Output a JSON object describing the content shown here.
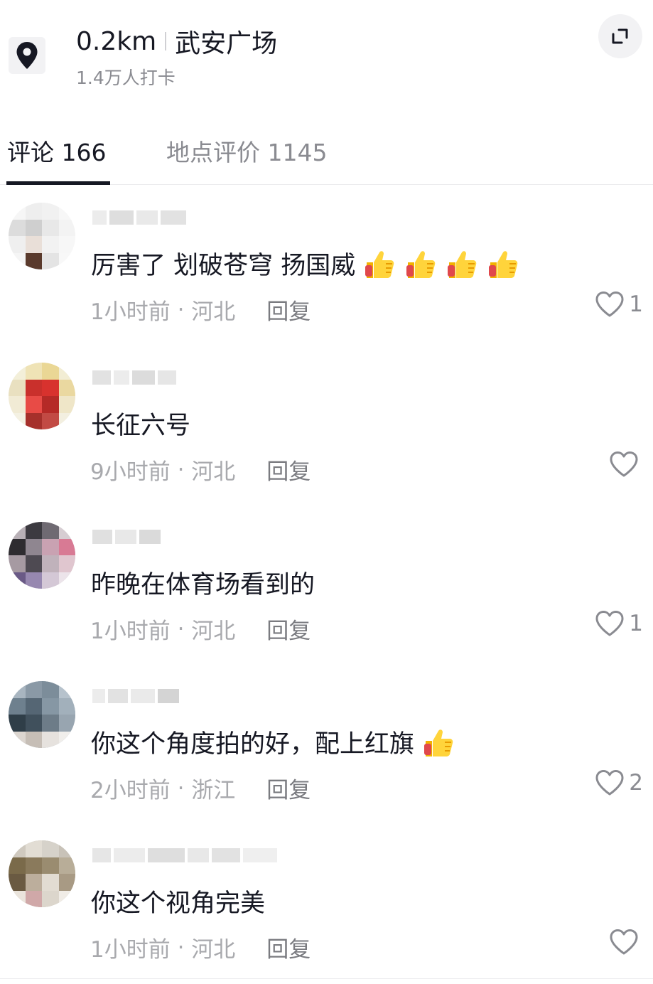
{
  "location": {
    "distance": "0.2km",
    "name": "武安广场",
    "checkins": "1.4万人打卡"
  },
  "tabs": {
    "comments": "评论 166",
    "reviews": "地点评价 1145"
  },
  "comments": [
    {
      "text": "厉害了  划破苍穹  扬国威",
      "thumbs": 4,
      "time": "1小时前",
      "region": "河北",
      "reply": "回复",
      "likes": "1"
    },
    {
      "text": "长征六号",
      "thumbs": 0,
      "time": "9小时前",
      "region": "河北",
      "reply": "回复",
      "likes": ""
    },
    {
      "text": "昨晚在体育场看到的",
      "thumbs": 0,
      "time": "1小时前",
      "region": "河北",
      "reply": "回复",
      "likes": "1"
    },
    {
      "text": "你这个角度拍的好，配上红旗",
      "thumbs": 1,
      "time": "2小时前",
      "region": "浙江",
      "reply": "回复",
      "likes": "2"
    },
    {
      "text": "你这个视角完美",
      "thumbs": 0,
      "time": "1小时前",
      "region": "河北",
      "reply": "回复",
      "likes": ""
    }
  ],
  "icons": {
    "pin": "location-pin-icon",
    "expand": "expand-icon",
    "like": "heart-icon",
    "emoji": "thumbs-up-emoji-icon"
  },
  "colors": {
    "text_primary": "#161823",
    "text_secondary": "#8a8b91",
    "meta": "#a8a9ad",
    "tab_underline": "#161823"
  }
}
